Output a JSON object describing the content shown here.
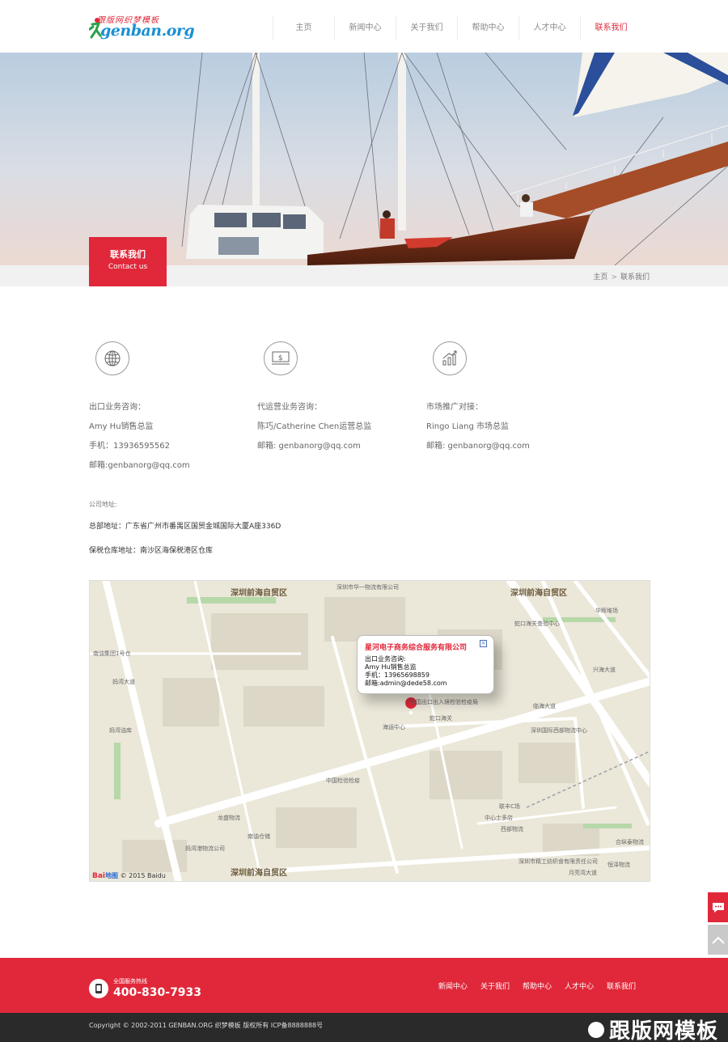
{
  "header": {
    "logo_tag": "跟版网织梦模板",
    "logo_word": "genban.org",
    "nav": [
      "主页",
      "新闻中心",
      "关于我们",
      "帮助中心",
      "人才中心",
      "联系我们"
    ],
    "active_index": 5
  },
  "banner": {
    "label_cn": "联系我们",
    "label_en": "Contact us"
  },
  "breadcrumb": {
    "home": "主页",
    "separator": ">",
    "current": "联系我们"
  },
  "contacts": [
    {
      "icon": "globe-icon",
      "lines": [
        "出口业务咨询：",
        "Amy Hu销售总监",
        "手机：13936595562",
        "邮箱:genbanorg@qq.com"
      ]
    },
    {
      "icon": "dollar-screen-icon",
      "lines": [
        "代运营业务咨询：",
        "陈巧/Catherine Chen运营总监",
        "邮箱: genbanorg@qq.com"
      ]
    },
    {
      "icon": "growth-chart-icon",
      "lines": [
        "市场推广对接：",
        "Ringo Liang 市场总监",
        "邮箱: genbanorg@qq.com"
      ]
    }
  ],
  "address": {
    "label": "公司地址:",
    "lines": [
      "总部地址：广东省广州市番禺区国贸金城国际大厦A座336D",
      "保税仓库地址：南沙区海保税港区仓库"
    ]
  },
  "map": {
    "popup_title": "星河电子商务综合服务有限公司",
    "popup_lines": [
      "出口业务咨询:",
      "Amy Hu销售总监",
      "手机：13965698859",
      "邮箱:admin@dede58.com"
    ],
    "close": "×",
    "big_labels": [
      "深圳前海自贸区",
      "深圳前海自贸区",
      "深圳前海自贸区"
    ],
    "labels": [
      "深圳市华一物流有限公司",
      "南油集团1号仓",
      "蛇口海关查验中心",
      "华辉堆场",
      "妈湾大道",
      "临海大道",
      "中国出口出入境检验检疫局",
      "蛇口海关",
      "海运中心",
      "深圳国际西部物流中心",
      "兴海大道",
      "妈湾油库",
      "中国检验检疫",
      "龙盛物流",
      "南油仓储",
      "妈湾港物流公司",
      "联丰C场",
      "中心士多店",
      "西部物流",
      "深圳市精工纺织食有限责任公司",
      "月亮湾大道",
      "恒泽物流",
      "合纵泰物流"
    ],
    "copyright": "© 2015 Baidu",
    "brand_a": "Bai",
    "brand_b": "地图"
  },
  "footer": {
    "hotline_label": "全国服务热线",
    "hotline": "400-830-7933",
    "links": [
      "新闻中心",
      "关于我们",
      "帮助中心",
      "人才中心",
      "联系我们"
    ],
    "copyright": "Copyright © 2002-2011 GENBAN.ORG 织梦模板 版权所有 ICP备8888888号",
    "watermark": "跟版网模板"
  },
  "colors": {
    "accent": "#e0283a",
    "footer_dark": "#2a2a2a"
  }
}
